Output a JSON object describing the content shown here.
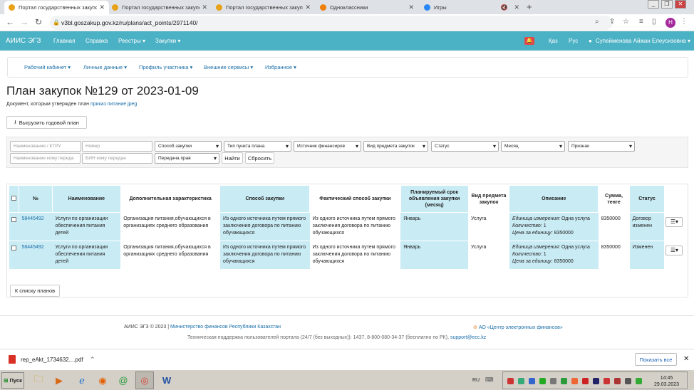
{
  "browser": {
    "tabs": [
      {
        "title": "Портал государственных закупок",
        "fav": "#e8a21a"
      },
      {
        "title": "Портал государственных закупок",
        "fav": "#e8a21a"
      },
      {
        "title": "Портал государственных закупок",
        "fav": "#e8a21a"
      },
      {
        "title": "Одноклассники",
        "fav": "#f07f09"
      },
      {
        "title": "Игры",
        "fav": "#2787f5"
      }
    ],
    "new_tab": "+",
    "url": "v3bl.goszakup.gov.kz/ru/plans/act_points/2971140/",
    "profile_letter": "H"
  },
  "topnav": {
    "brand": "АИИС ЭГЗ",
    "items": [
      "Главная",
      "Справка",
      "Реестры ▾",
      "Закупки ▾"
    ],
    "lang_kz": "Қаз",
    "lang_ru": "Рус",
    "user": "Супейменова Айжан Елеусизовна ▾"
  },
  "subnav": [
    "Рабочий кабинет ▾",
    "Личные данные ▾",
    "Профиль участника ▾",
    "Внешние сервисы ▾",
    "Избранное ▾"
  ],
  "page": {
    "title": "План закупок №129 от 2023-01-09",
    "doc_prefix": "Документ, которым утвержден план",
    "doc_link": "приказ питание.jpeg",
    "export_button": "Выгрузить годовой план",
    "back_button": "К списку планов"
  },
  "filters": {
    "row1": [
      {
        "kind": "input",
        "placeholder": "Наименование / КТРУ"
      },
      {
        "kind": "input",
        "placeholder": "Номер"
      },
      {
        "kind": "select",
        "value": "Способ закупки"
      },
      {
        "kind": "select",
        "value": "Тип пункта плана"
      },
      {
        "kind": "select",
        "value": "Источник финансиров"
      },
      {
        "kind": "select",
        "value": "Вид предмета закупок"
      },
      {
        "kind": "select",
        "value": "Статус"
      },
      {
        "kind": "select",
        "value": "Месяц"
      },
      {
        "kind": "select",
        "value": "Признак"
      }
    ],
    "row2": [
      {
        "kind": "input",
        "placeholder": "Наименование кому переда"
      },
      {
        "kind": "input",
        "placeholder": "БИН кому передан"
      },
      {
        "kind": "select",
        "value": "Передача прав"
      }
    ],
    "search_button": "Найти",
    "reset_button": "Сбросить"
  },
  "table": {
    "headers": [
      "№",
      "Наименование",
      "Дополнительная характеристика",
      "Способ закупки",
      "Фактический способ закупки",
      "Планируемый срок объявления закупки (месяц)",
      "Вид предмета закупок",
      "Описание",
      "Сумма, тенге",
      "Статус"
    ],
    "rows": [
      {
        "num": "58445492",
        "name": "Услуги по организации обеспечения питания детей",
        "extra": "Организация питания,обучающихся в организациях среднего образования",
        "method": "Из одного источника путем прямого заключения договора по питанию обучающихся",
        "fact_method": "Из одного источника путем прямого заключения договора по питанию обучающихся",
        "month": "Январь",
        "kind": "Услуга",
        "desc_unit_label": "Единица измерения:",
        "desc_unit": " Одна услуга",
        "desc_qty_label": "Количество:",
        "desc_qty": " 1",
        "desc_price_label": "Цена за единицу:",
        "desc_price": " 8350000",
        "sum": "8350000",
        "status": "Договор изменен"
      },
      {
        "num": "58445492",
        "name": "Услуги по организации обеспечения питания детей",
        "extra": "Организация питания,обучающихся в организациях среднего образования",
        "method": "Из одного источника путем прямого заключения договора по питанию обучающихся",
        "fact_method": "Из одного источника путем прямого заключения договора по питанию обучающихся",
        "month": "Январь",
        "kind": "Услуга",
        "desc_unit_label": "Единица измерения:",
        "desc_unit": " Одна услуга",
        "desc_qty_label": "Количество:",
        "desc_qty": " 1",
        "desc_price_label": "Цена за единицу:",
        "desc_price": " 8350000",
        "sum": "8350000",
        "status": "Изменен"
      }
    ]
  },
  "footer": {
    "copyright": "АИИС ЭГЗ © 2023 | ",
    "ministry": "Министерство финансов Республики Казахстан",
    "center": "АО «Центр электронных финансов»",
    "support_text": "Техническая поддержка пользователей портала (24/7 (без выходных)): 1437, 8-800-080-34-37 (бесплатно по РК), ",
    "support_email": "support@ecc.kz"
  },
  "download": {
    "filename": "rep_eAkt_1734632....pdf",
    "show_all": "Показать все"
  },
  "taskbar": {
    "start": "Пуск",
    "lang": "RU",
    "time": "14:45",
    "date": "29.03.2023"
  }
}
